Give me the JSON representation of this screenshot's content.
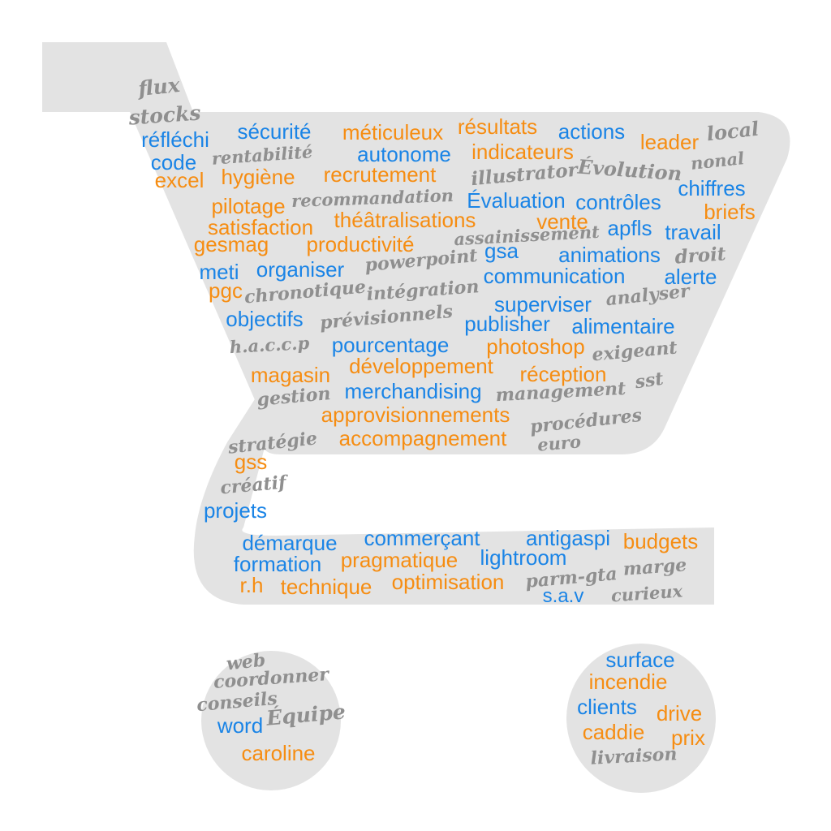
{
  "palette": {
    "blue": "#1a84e6",
    "orange": "#f68d12",
    "gray": "#8f8f8f",
    "cart_fill": "#e3e3e3"
  },
  "shape": "shopping-cart-icon",
  "words": [
    {
      "text": "flux",
      "color": "gray"
    },
    {
      "text": "stocks",
      "color": "gray"
    },
    {
      "text": "réfléchi",
      "color": "blue"
    },
    {
      "text": "sécurité",
      "color": "blue"
    },
    {
      "text": "méticuleux",
      "color": "orange"
    },
    {
      "text": "résultats",
      "color": "orange"
    },
    {
      "text": "actions",
      "color": "blue"
    },
    {
      "text": "leader",
      "color": "orange"
    },
    {
      "text": "local",
      "color": "gray"
    },
    {
      "text": "code",
      "color": "blue"
    },
    {
      "text": "rentabilité",
      "color": "gray"
    },
    {
      "text": "autonome",
      "color": "blue"
    },
    {
      "text": "indicateurs",
      "color": "orange"
    },
    {
      "text": "nonal",
      "color": "gray"
    },
    {
      "text": "excel",
      "color": "orange"
    },
    {
      "text": "hygiène",
      "color": "orange"
    },
    {
      "text": "recrutement",
      "color": "orange"
    },
    {
      "text": "illustrator",
      "color": "gray"
    },
    {
      "text": "Évolution",
      "color": "gray"
    },
    {
      "text": "chiffres",
      "color": "blue"
    },
    {
      "text": "pilotage",
      "color": "orange"
    },
    {
      "text": "recommandation",
      "color": "gray"
    },
    {
      "text": "Évaluation",
      "color": "blue"
    },
    {
      "text": "contrôles",
      "color": "blue"
    },
    {
      "text": "briefs",
      "color": "orange"
    },
    {
      "text": "satisfaction",
      "color": "orange"
    },
    {
      "text": "théâtralisations",
      "color": "orange"
    },
    {
      "text": "vente",
      "color": "orange"
    },
    {
      "text": "apfls",
      "color": "blue"
    },
    {
      "text": "travail",
      "color": "blue"
    },
    {
      "text": "gesmag",
      "color": "orange"
    },
    {
      "text": "productivité",
      "color": "orange"
    },
    {
      "text": "assainissement",
      "color": "gray"
    },
    {
      "text": "gsa",
      "color": "blue"
    },
    {
      "text": "powerpoint",
      "color": "gray"
    },
    {
      "text": "animations",
      "color": "blue"
    },
    {
      "text": "droit",
      "color": "gray"
    },
    {
      "text": "meti",
      "color": "blue"
    },
    {
      "text": "organiser",
      "color": "blue"
    },
    {
      "text": "communication",
      "color": "blue"
    },
    {
      "text": "alerte",
      "color": "blue"
    },
    {
      "text": "pgc",
      "color": "orange"
    },
    {
      "text": "chronotique",
      "color": "gray"
    },
    {
      "text": "intégration",
      "color": "gray"
    },
    {
      "text": "analyser",
      "color": "gray"
    },
    {
      "text": "superviser",
      "color": "blue"
    },
    {
      "text": "objectifs",
      "color": "blue"
    },
    {
      "text": "prévisionnels",
      "color": "gray"
    },
    {
      "text": "publisher",
      "color": "blue"
    },
    {
      "text": "alimentaire",
      "color": "blue"
    },
    {
      "text": "h.a.c.c.p",
      "color": "gray"
    },
    {
      "text": "pourcentage",
      "color": "blue"
    },
    {
      "text": "photoshop",
      "color": "orange"
    },
    {
      "text": "exigeant",
      "color": "gray"
    },
    {
      "text": "magasin",
      "color": "orange"
    },
    {
      "text": "développement",
      "color": "orange"
    },
    {
      "text": "réception",
      "color": "orange"
    },
    {
      "text": "sst",
      "color": "gray"
    },
    {
      "text": "gestion",
      "color": "gray"
    },
    {
      "text": "merchandising",
      "color": "blue"
    },
    {
      "text": "management",
      "color": "gray"
    },
    {
      "text": "approvisionnements",
      "color": "orange"
    },
    {
      "text": "procédures",
      "color": "gray"
    },
    {
      "text": "stratégie",
      "color": "gray"
    },
    {
      "text": "accompagnement",
      "color": "orange"
    },
    {
      "text": "euro",
      "color": "gray"
    },
    {
      "text": "gss",
      "color": "orange"
    },
    {
      "text": "créatif",
      "color": "gray"
    },
    {
      "text": "projets",
      "color": "blue"
    },
    {
      "text": "démarque",
      "color": "blue"
    },
    {
      "text": "commerçant",
      "color": "blue"
    },
    {
      "text": "antigaspi",
      "color": "blue"
    },
    {
      "text": "budgets",
      "color": "orange"
    },
    {
      "text": "formation",
      "color": "blue"
    },
    {
      "text": "pragmatique",
      "color": "orange"
    },
    {
      "text": "lightroom",
      "color": "blue"
    },
    {
      "text": "marge",
      "color": "gray"
    },
    {
      "text": "r.h",
      "color": "orange"
    },
    {
      "text": "technique",
      "color": "orange"
    },
    {
      "text": "optimisation",
      "color": "orange"
    },
    {
      "text": "parm-gta",
      "color": "gray"
    },
    {
      "text": "curieux",
      "color": "gray"
    },
    {
      "text": "s.a.v",
      "color": "blue"
    },
    {
      "text": "web",
      "color": "gray"
    },
    {
      "text": "coordonner",
      "color": "gray"
    },
    {
      "text": "conseils",
      "color": "gray"
    },
    {
      "text": "Équipe",
      "color": "gray"
    },
    {
      "text": "word",
      "color": "blue"
    },
    {
      "text": "caroline",
      "color": "orange"
    },
    {
      "text": "surface",
      "color": "blue"
    },
    {
      "text": "incendie",
      "color": "orange"
    },
    {
      "text": "clients",
      "color": "blue"
    },
    {
      "text": "drive",
      "color": "orange"
    },
    {
      "text": "caddie",
      "color": "orange"
    },
    {
      "text": "prix",
      "color": "orange"
    },
    {
      "text": "livraison",
      "color": "gray"
    }
  ]
}
